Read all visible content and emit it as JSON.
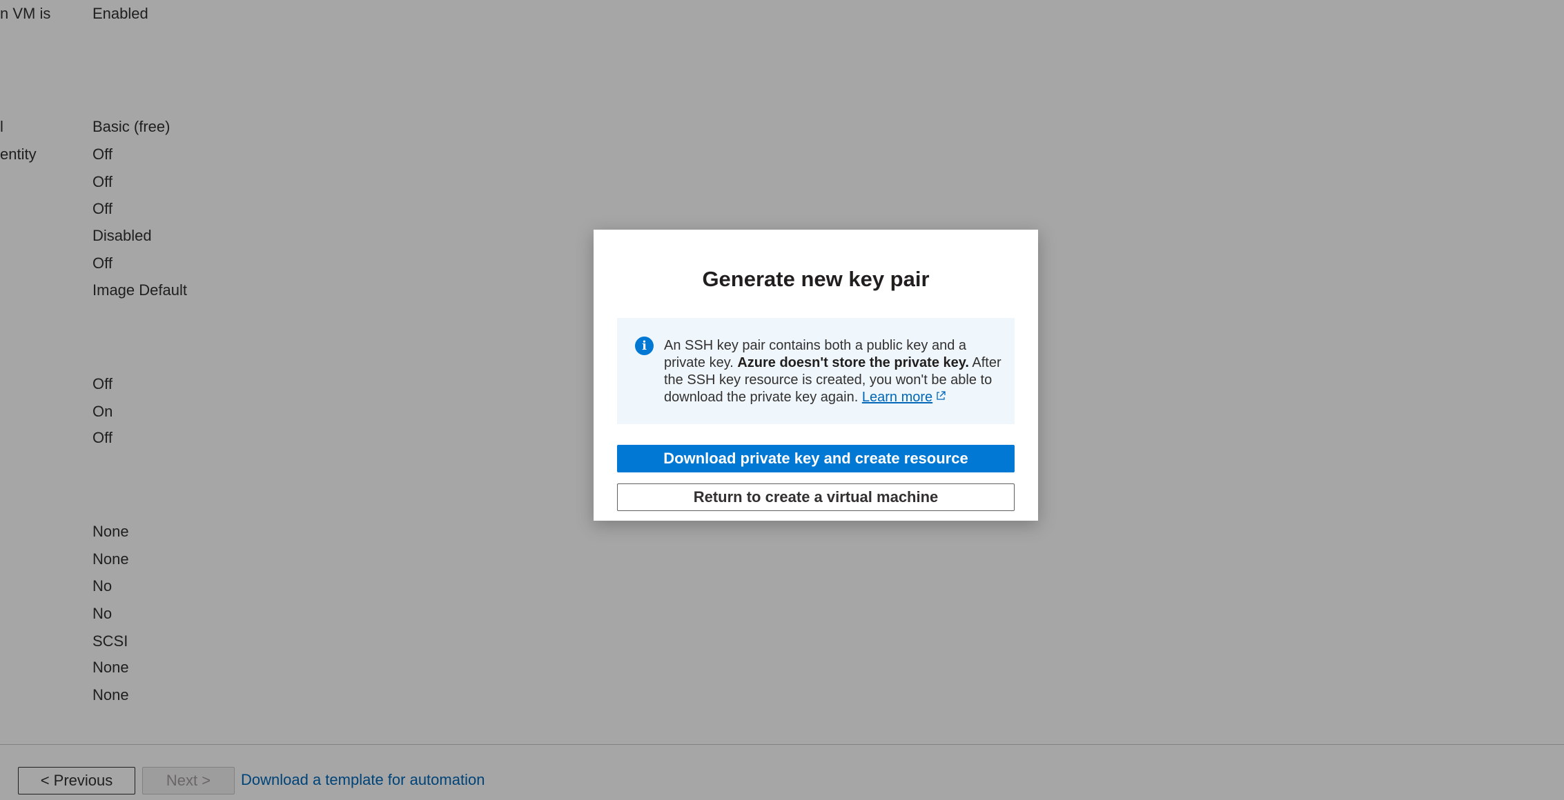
{
  "summary_rows": [
    {
      "label": "n VM is",
      "value": "Enabled"
    },
    {
      "label": "l",
      "value": "Basic (free)"
    },
    {
      "label": "entity",
      "value": "Off"
    },
    {
      "label": "",
      "value": "Off"
    },
    {
      "label": "",
      "value": "Off"
    },
    {
      "label": "",
      "value": "Disabled"
    },
    {
      "label": "",
      "value": "Off"
    },
    {
      "label": "",
      "value": "Image Default"
    },
    {
      "label": "",
      "value": "Off"
    },
    {
      "label": "",
      "value": "On"
    },
    {
      "label": "",
      "value": "Off"
    },
    {
      "label": "",
      "value": "None"
    },
    {
      "label": "",
      "value": "None"
    },
    {
      "label": "",
      "value": "No"
    },
    {
      "label": "",
      "value": "No"
    },
    {
      "label": "",
      "value": "SCSI"
    },
    {
      "label": "",
      "value": "None"
    },
    {
      "label": "",
      "value": "None"
    }
  ],
  "footer": {
    "previous_label": "< Previous",
    "next_label": "Next >",
    "template_link": "Download a template for automation"
  },
  "dialog": {
    "title": "Generate new key pair",
    "info_icon": "info-icon",
    "info_text_1": "An SSH key pair contains both a public key and a private key. ",
    "info_text_bold": "Azure doesn't store the private key.",
    "info_text_2": " After the SSH key resource is created, you won't be able to download the private key again. ",
    "learn_more": "Learn more",
    "primary_button": "Download private key and create resource",
    "secondary_button": "Return to create a virtual machine"
  },
  "colors": {
    "accent": "#0078d4",
    "link": "#0067b8",
    "info_background": "#eff6fc"
  }
}
